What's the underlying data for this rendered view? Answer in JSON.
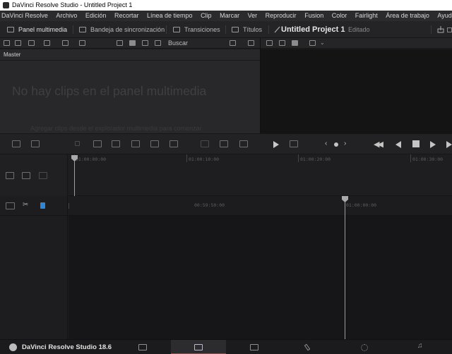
{
  "window": {
    "title": "DaVinci Resolve Studio - Untitled Project 1"
  },
  "menu": [
    "DaVinci Resolve",
    "Archivo",
    "Edición",
    "Recortar",
    "Línea de tiempo",
    "Clip",
    "Marcar",
    "Ver",
    "Reproducir",
    "Fusion",
    "Color",
    "Fairlight",
    "Área de trabajo",
    "Ayuda"
  ],
  "toolbar": {
    "media_pool": "Panel multimedia",
    "sync_bin": "Bandeja de sincronización",
    "transitions": "Transiciones",
    "titles": "Títulos",
    "project_title": "Untitled Project 1",
    "status": "Editado"
  },
  "media_pool": {
    "search_label": "Buscar",
    "bin_name": "Master",
    "empty_title": "No hay clips en el panel multimedia",
    "empty_hint": "Agregar clips desde el explorador multimedia para comenzar"
  },
  "timeline": {
    "upper_timecodes": [
      "01:00:00:00",
      "01:00:10:00",
      "01:00:20:00",
      "01:00:30:00"
    ],
    "lower_timecodes": [
      "00:59:50:00",
      "01:00:00:00"
    ]
  },
  "bottom": {
    "brand": "DaVinci Resolve Studio 18.6",
    "pages": [
      "media",
      "cut",
      "edit",
      "fusion",
      "color",
      "fairlight",
      "deliver"
    ],
    "active_page": "cut",
    "accent_color": "#e8264d"
  }
}
